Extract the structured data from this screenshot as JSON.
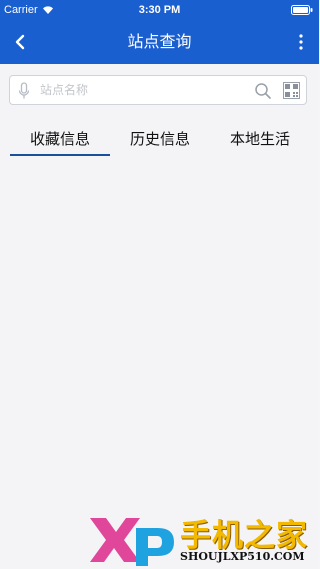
{
  "status_bar": {
    "carrier": "Carrier",
    "time": "3:30 PM"
  },
  "nav": {
    "title": "站点查询"
  },
  "search": {
    "placeholder": "站点名称",
    "value": ""
  },
  "tabs": [
    {
      "label": "收藏信息",
      "active": true
    },
    {
      "label": "历史信息",
      "active": false
    },
    {
      "label": "本地生活",
      "active": false
    }
  ],
  "watermark": {
    "brand_text": "手机之家",
    "url": "SHOUJLXP510.COM"
  },
  "colors": {
    "header": "#1a5fd0",
    "accent": "#1a4f9a",
    "background": "#f4f4f6"
  },
  "icons": [
    "wifi-icon",
    "battery-icon",
    "back-arrow-icon",
    "more-vertical-icon",
    "microphone-icon",
    "search-icon",
    "qr-code-icon"
  ]
}
